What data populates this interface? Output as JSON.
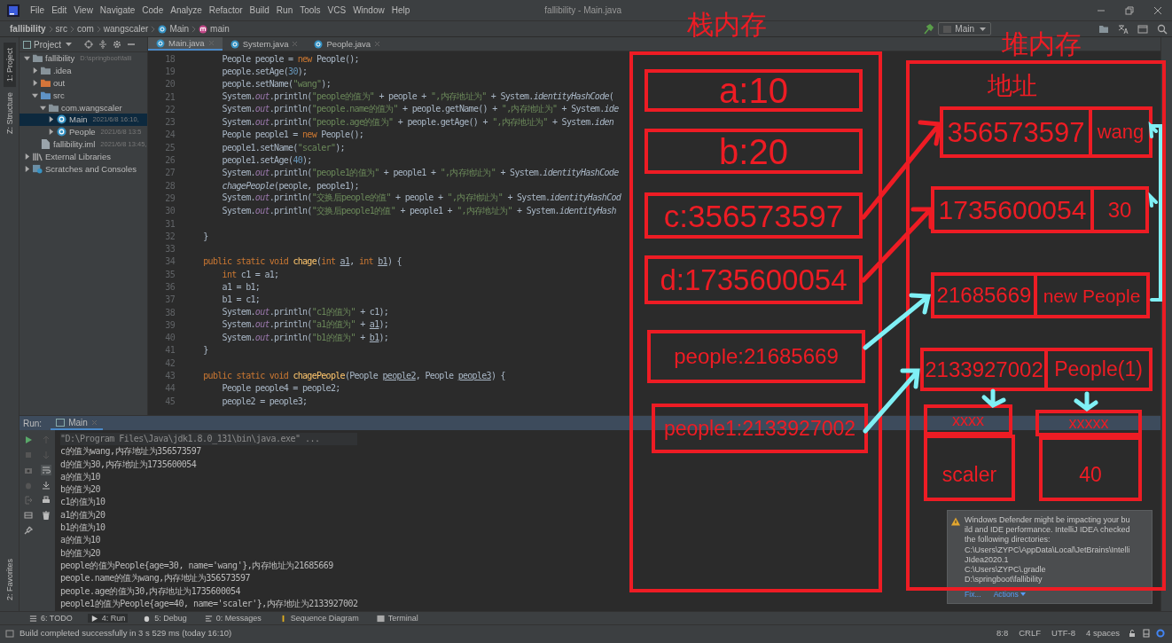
{
  "window": {
    "title": "fallibility - Main.java"
  },
  "menu": [
    "File",
    "Edit",
    "View",
    "Navigate",
    "Code",
    "Analyze",
    "Refactor",
    "Build",
    "Run",
    "Tools",
    "VCS",
    "Window",
    "Help"
  ],
  "breadcrumbs": [
    {
      "label": "fallibility",
      "kind": "plain"
    },
    {
      "label": "src",
      "kind": "plain"
    },
    {
      "label": "com",
      "kind": "plain"
    },
    {
      "label": "wangscaler",
      "kind": "plain"
    },
    {
      "label": "Main",
      "kind": "class"
    },
    {
      "label": "main",
      "kind": "method"
    }
  ],
  "run_config": "Main",
  "left_stripe": {
    "top": [
      {
        "label": "1: Project",
        "selected": true
      },
      {
        "label": "Z: Structure",
        "selected": false
      }
    ],
    "bottom": [
      {
        "label": "2: Favorites",
        "selected": false
      }
    ]
  },
  "project_panel": {
    "title": "Project",
    "tree": [
      {
        "label": "fallibility",
        "meta": "D:\\springboot\\falli",
        "kind": "project",
        "expanded": true,
        "selected": false,
        "children": [
          {
            "label": ".idea",
            "kind": "folder",
            "expanded": false,
            "selected": false
          },
          {
            "label": "out",
            "kind": "excluded",
            "expanded": false,
            "selected": false
          },
          {
            "label": "src",
            "kind": "source",
            "expanded": true,
            "selected": false,
            "children": [
              {
                "label": "com.wangscaler",
                "kind": "package",
                "expanded": true,
                "selected": false,
                "children": [
                  {
                    "label": "Main",
                    "meta": "2021/6/8 16:10,",
                    "kind": "class",
                    "expanded": false,
                    "selected": true
                  },
                  {
                    "label": "People",
                    "meta": "2021/6/8 13:5",
                    "kind": "class",
                    "expanded": false,
                    "selected": false
                  }
                ]
              }
            ]
          },
          {
            "label": "fallibility.iml",
            "meta": "2021/6/8 13:45,",
            "kind": "file",
            "selected": false
          }
        ]
      },
      {
        "label": "External Libraries",
        "kind": "library",
        "expanded": false,
        "selected": false
      },
      {
        "label": "Scratches and Consoles",
        "kind": "scratch",
        "expanded": false,
        "selected": false
      }
    ]
  },
  "editor": {
    "tabs": [
      {
        "label": "Main.java",
        "selected": true
      },
      {
        "label": "System.java",
        "selected": false
      },
      {
        "label": "People.java",
        "selected": false
      }
    ],
    "lines": [
      {
        "num": "18",
        "tokens": [
          {
            "text": "        People people = ",
            "kind": "plain"
          },
          {
            "text": "new",
            "kind": "kw"
          },
          {
            "text": " People();",
            "kind": "plain"
          }
        ]
      },
      {
        "num": "19",
        "tokens": [
          {
            "text": "        people.setAge(",
            "kind": "plain"
          },
          {
            "text": "30",
            "kind": "num"
          },
          {
            "text": ");",
            "kind": "plain"
          }
        ]
      },
      {
        "num": "20",
        "tokens": [
          {
            "text": "        people.setName(",
            "kind": "plain"
          },
          {
            "text": "\"wang\"",
            "kind": "str"
          },
          {
            "text": ");",
            "kind": "plain"
          }
        ]
      },
      {
        "num": "21",
        "tokens": [
          {
            "text": "        System.",
            "kind": "plain"
          },
          {
            "text": "out",
            "kind": "field"
          },
          {
            "text": ".println(",
            "kind": "plain"
          },
          {
            "text": "\"people的值为\"",
            "kind": "str"
          },
          {
            "text": " + people + ",
            "kind": "plain"
          },
          {
            "text": "\",内存地址为\"",
            "kind": "str"
          },
          {
            "text": " + System.",
            "kind": "plain"
          },
          {
            "text": "identityHashCode",
            "kind": "ital"
          },
          {
            "text": "(",
            "kind": "plain"
          }
        ]
      },
      {
        "num": "22",
        "tokens": [
          {
            "text": "        System.",
            "kind": "plain"
          },
          {
            "text": "out",
            "kind": "field"
          },
          {
            "text": ".println(",
            "kind": "plain"
          },
          {
            "text": "\"people.name的值为\"",
            "kind": "str"
          },
          {
            "text": " + people.getName() + ",
            "kind": "plain"
          },
          {
            "text": "\",内存地址为\"",
            "kind": "str"
          },
          {
            "text": " + System.",
            "kind": "plain"
          },
          {
            "text": "ide",
            "kind": "ital"
          }
        ]
      },
      {
        "num": "23",
        "tokens": [
          {
            "text": "        System.",
            "kind": "plain"
          },
          {
            "text": "out",
            "kind": "field"
          },
          {
            "text": ".println(",
            "kind": "plain"
          },
          {
            "text": "\"people.age的值为\"",
            "kind": "str"
          },
          {
            "text": " + people.getAge() + ",
            "kind": "plain"
          },
          {
            "text": "\",内存地址为\"",
            "kind": "str"
          },
          {
            "text": " + System.",
            "kind": "plain"
          },
          {
            "text": "iden",
            "kind": "ital"
          }
        ]
      },
      {
        "num": "24",
        "tokens": [
          {
            "text": "        People people1 = ",
            "kind": "plain"
          },
          {
            "text": "new",
            "kind": "kw"
          },
          {
            "text": " People();",
            "kind": "plain"
          }
        ]
      },
      {
        "num": "25",
        "tokens": [
          {
            "text": "        people1.setName(",
            "kind": "plain"
          },
          {
            "text": "\"scaler\"",
            "kind": "str"
          },
          {
            "text": ");",
            "kind": "plain"
          }
        ]
      },
      {
        "num": "26",
        "tokens": [
          {
            "text": "        people1.setAge(",
            "kind": "plain"
          },
          {
            "text": "40",
            "kind": "num"
          },
          {
            "text": ");",
            "kind": "plain"
          }
        ]
      },
      {
        "num": "27",
        "tokens": [
          {
            "text": "        System.",
            "kind": "plain"
          },
          {
            "text": "out",
            "kind": "field"
          },
          {
            "text": ".println(",
            "kind": "plain"
          },
          {
            "text": "\"people1的值为\"",
            "kind": "str"
          },
          {
            "text": " + people1 + ",
            "kind": "plain"
          },
          {
            "text": "\",内存地址为\"",
            "kind": "str"
          },
          {
            "text": " + System.",
            "kind": "plain"
          },
          {
            "text": "identityHashCode",
            "kind": "ital"
          }
        ]
      },
      {
        "num": "28",
        "tokens": [
          {
            "text": "        chagePeople",
            "kind": "ital"
          },
          {
            "text": "(people, people1);",
            "kind": "plain"
          }
        ]
      },
      {
        "num": "29",
        "tokens": [
          {
            "text": "        System.",
            "kind": "plain"
          },
          {
            "text": "out",
            "kind": "field"
          },
          {
            "text": ".println(",
            "kind": "plain"
          },
          {
            "text": "\"交换后people的值\"",
            "kind": "str"
          },
          {
            "text": " + people + ",
            "kind": "plain"
          },
          {
            "text": "\",内存地址为\"",
            "kind": "str"
          },
          {
            "text": " + System.",
            "kind": "plain"
          },
          {
            "text": "identityHashCod",
            "kind": "ital"
          }
        ]
      },
      {
        "num": "30",
        "tokens": [
          {
            "text": "        System.",
            "kind": "plain"
          },
          {
            "text": "out",
            "kind": "field"
          },
          {
            "text": ".println(",
            "kind": "plain"
          },
          {
            "text": "\"交换后people1的值\"",
            "kind": "str"
          },
          {
            "text": " + people1 + ",
            "kind": "plain"
          },
          {
            "text": "\",内存地址为\"",
            "kind": "str"
          },
          {
            "text": " + System.",
            "kind": "plain"
          },
          {
            "text": "identityHash",
            "kind": "ital"
          }
        ]
      },
      {
        "num": "31"
      },
      {
        "num": "32",
        "tokens": [
          {
            "text": "    }",
            "kind": "plain"
          }
        ]
      },
      {
        "num": "33"
      },
      {
        "num": "34",
        "tokens": [
          {
            "text": "    public static void ",
            "kind": "kw"
          },
          {
            "text": "chage",
            "kind": "decl"
          },
          {
            "text": "(",
            "kind": "plain"
          },
          {
            "text": "int ",
            "kind": "kw"
          },
          {
            "text": "a1",
            "kind": "ul"
          },
          {
            "text": ", ",
            "kind": "plain"
          },
          {
            "text": "int ",
            "kind": "kw"
          },
          {
            "text": "b1",
            "kind": "ul"
          },
          {
            "text": ") {",
            "kind": "plain"
          }
        ]
      },
      {
        "num": "35",
        "tokens": [
          {
            "text": "        int ",
            "kind": "kw"
          },
          {
            "text": "c1 = a1;",
            "kind": "plain"
          }
        ]
      },
      {
        "num": "36",
        "tokens": [
          {
            "text": "        a1 = b1;",
            "kind": "plain"
          }
        ]
      },
      {
        "num": "37",
        "tokens": [
          {
            "text": "        b1 = c1;",
            "kind": "plain"
          }
        ]
      },
      {
        "num": "38",
        "tokens": [
          {
            "text": "        System.",
            "kind": "plain"
          },
          {
            "text": "out",
            "kind": "field"
          },
          {
            "text": ".println(",
            "kind": "plain"
          },
          {
            "text": "\"c1的值为\"",
            "kind": "str"
          },
          {
            "text": " + c1);",
            "kind": "plain"
          }
        ]
      },
      {
        "num": "39",
        "tokens": [
          {
            "text": "        System.",
            "kind": "plain"
          },
          {
            "text": "out",
            "kind": "field"
          },
          {
            "text": ".println(",
            "kind": "plain"
          },
          {
            "text": "\"a1的值为\"",
            "kind": "str"
          },
          {
            "text": " + ",
            "kind": "plain"
          },
          {
            "text": "a1",
            "kind": "ul"
          },
          {
            "text": ");",
            "kind": "plain"
          }
        ]
      },
      {
        "num": "40",
        "tokens": [
          {
            "text": "        System.",
            "kind": "plain"
          },
          {
            "text": "out",
            "kind": "field"
          },
          {
            "text": ".println(",
            "kind": "plain"
          },
          {
            "text": "\"b1的值为\"",
            "kind": "str"
          },
          {
            "text": " + ",
            "kind": "plain"
          },
          {
            "text": "b1",
            "kind": "ul"
          },
          {
            "text": ");",
            "kind": "plain"
          }
        ]
      },
      {
        "num": "41",
        "tokens": [
          {
            "text": "    }",
            "kind": "plain"
          }
        ]
      },
      {
        "num": "42"
      },
      {
        "num": "43",
        "tokens": [
          {
            "text": "    public static void ",
            "kind": "kw"
          },
          {
            "text": "chagePeople",
            "kind": "decl"
          },
          {
            "text": "(People ",
            "kind": "plain"
          },
          {
            "text": "people2",
            "kind": "ul"
          },
          {
            "text": ", People ",
            "kind": "plain"
          },
          {
            "text": "people3",
            "kind": "ul"
          },
          {
            "text": ") {",
            "kind": "plain"
          }
        ]
      },
      {
        "num": "44",
        "tokens": [
          {
            "text": "        People people4 = people2;",
            "kind": "plain"
          }
        ]
      },
      {
        "num": "45",
        "tokens": [
          {
            "text": "        people2 = people3;",
            "kind": "plain"
          }
        ]
      }
    ]
  },
  "run_panel": {
    "title": "Run:",
    "tab": "Main",
    "console": [
      {
        "text": "\"D:\\Program Files\\Java\\jdk1.8.0_131\\bin\\java.exe\" ...",
        "kind": "command"
      },
      {
        "text": "c的值为wang,内存地址为356573597",
        "kind": "output"
      },
      {
        "text": "d的值为30,内存地址为1735600054",
        "kind": "output"
      },
      {
        "text": "a的值为10",
        "kind": "output"
      },
      {
        "text": "b的值为20",
        "kind": "output"
      },
      {
        "text": "c1的值为10",
        "kind": "output"
      },
      {
        "text": "a1的值为20",
        "kind": "output"
      },
      {
        "text": "b1的值为10",
        "kind": "output"
      },
      {
        "text": "a的值为10",
        "kind": "output"
      },
      {
        "text": "b的值为20",
        "kind": "output"
      },
      {
        "text": "people的值为People{age=30, name='wang'},内存地址为21685669",
        "kind": "output"
      },
      {
        "text": "people.name的值为wang,内存地址为356573597",
        "kind": "output"
      },
      {
        "text": "people.age的值为30,内存地址为1735600054",
        "kind": "output"
      },
      {
        "text": "people1的值为People{age=40, name='scaler'},内存地址为2133927002",
        "kind": "output"
      }
    ]
  },
  "tool_buttons": [
    {
      "label": "6: TODO",
      "kind": "todo",
      "selected": false
    },
    {
      "label": "4: Run",
      "kind": "run",
      "selected": true
    },
    {
      "label": "5: Debug",
      "kind": "debug",
      "selected": false
    },
    {
      "label": "0: Messages",
      "kind": "messages",
      "selected": false
    },
    {
      "label": "Sequence Diagram",
      "kind": "diagram",
      "selected": false
    },
    {
      "label": "Terminal",
      "kind": "terminal",
      "selected": false
    }
  ],
  "status_bar": {
    "message": "Build completed successfully in 3 s 529 ms (today 16:10)",
    "items": [
      "8:8",
      "CRLF",
      "UTF-8",
      "4 spaces"
    ]
  },
  "notification": {
    "message": "Windows Defender might be impacting your build and IDE performance. IntelliJ IDEA checked the following directories:\nC:\\Users\\ZYPC\\AppData\\Local\\JetBrains\\IntelliJIdea2020.1\nC:\\Users\\ZYPC\\.gradle\nD:\\springboot\\fallibility",
    "actions": [
      "Fix...",
      "Actions"
    ]
  },
  "annotations": {
    "stack": {
      "title": "栈内存",
      "cells": [
        "a:10",
        "b:20",
        "c:356573597",
        "d:1735600054",
        "people:21685669",
        "people1:2133927002"
      ]
    },
    "heap": {
      "title": "堆内存",
      "label": "地址",
      "objects": [
        {
          "address": "356573597",
          "value": "wang"
        },
        {
          "address": "1735600054",
          "value": "30"
        },
        {
          "address": "21685669",
          "value": "new People"
        },
        {
          "address": "2133927002",
          "value": "People(1)"
        }
      ],
      "fields": [
        {
          "header": "xxxx",
          "value": "scaler"
        },
        {
          "header": "xxxxx",
          "value": "40"
        }
      ]
    }
  }
}
